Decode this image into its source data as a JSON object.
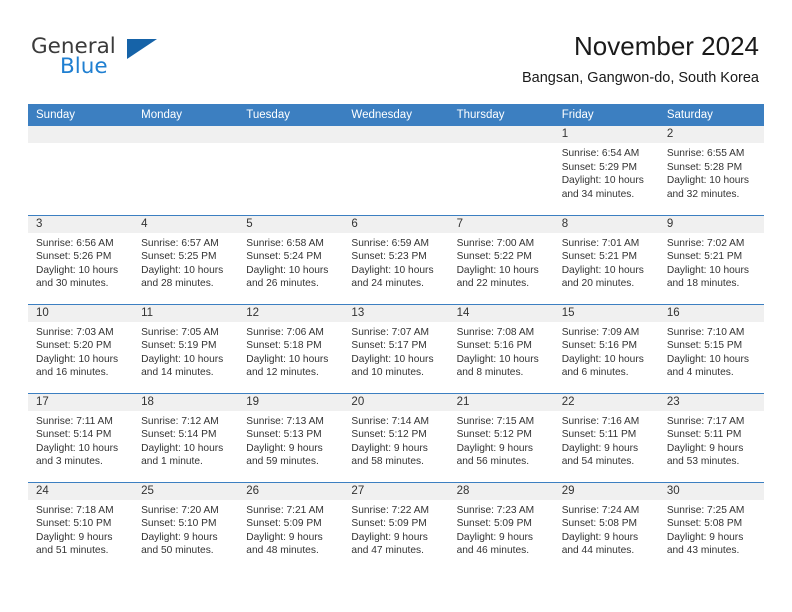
{
  "logo": {
    "word1": "General",
    "word2": "Blue",
    "triangle_color": "#1663a8",
    "blue_text_color": "#1f7fd1"
  },
  "header": {
    "title": "November 2024",
    "location": "Bangsan, Gangwon-do, South Korea"
  },
  "theme": {
    "header_blue": "#3c7fc1",
    "daynum_band": "#f0f0f0",
    "text": "#333333"
  },
  "weekday_headers": [
    "Sunday",
    "Monday",
    "Tuesday",
    "Wednesday",
    "Thursday",
    "Friday",
    "Saturday"
  ],
  "labels": {
    "sunrise_prefix": "Sunrise:",
    "sunset_prefix": "Sunset:",
    "daylight_prefix": "Daylight:"
  },
  "weeks": [
    [
      {
        "day": "",
        "empty": true
      },
      {
        "day": "",
        "empty": true
      },
      {
        "day": "",
        "empty": true
      },
      {
        "day": "",
        "empty": true
      },
      {
        "day": "",
        "empty": true
      },
      {
        "day": "1",
        "sunrise": "Sunrise: 6:54 AM",
        "sunset": "Sunset: 5:29 PM",
        "daylight": "Daylight: 10 hours and 34 minutes."
      },
      {
        "day": "2",
        "sunrise": "Sunrise: 6:55 AM",
        "sunset": "Sunset: 5:28 PM",
        "daylight": "Daylight: 10 hours and 32 minutes."
      }
    ],
    [
      {
        "day": "3",
        "sunrise": "Sunrise: 6:56 AM",
        "sunset": "Sunset: 5:26 PM",
        "daylight": "Daylight: 10 hours and 30 minutes."
      },
      {
        "day": "4",
        "sunrise": "Sunrise: 6:57 AM",
        "sunset": "Sunset: 5:25 PM",
        "daylight": "Daylight: 10 hours and 28 minutes."
      },
      {
        "day": "5",
        "sunrise": "Sunrise: 6:58 AM",
        "sunset": "Sunset: 5:24 PM",
        "daylight": "Daylight: 10 hours and 26 minutes."
      },
      {
        "day": "6",
        "sunrise": "Sunrise: 6:59 AM",
        "sunset": "Sunset: 5:23 PM",
        "daylight": "Daylight: 10 hours and 24 minutes."
      },
      {
        "day": "7",
        "sunrise": "Sunrise: 7:00 AM",
        "sunset": "Sunset: 5:22 PM",
        "daylight": "Daylight: 10 hours and 22 minutes."
      },
      {
        "day": "8",
        "sunrise": "Sunrise: 7:01 AM",
        "sunset": "Sunset: 5:21 PM",
        "daylight": "Daylight: 10 hours and 20 minutes."
      },
      {
        "day": "9",
        "sunrise": "Sunrise: 7:02 AM",
        "sunset": "Sunset: 5:21 PM",
        "daylight": "Daylight: 10 hours and 18 minutes."
      }
    ],
    [
      {
        "day": "10",
        "sunrise": "Sunrise: 7:03 AM",
        "sunset": "Sunset: 5:20 PM",
        "daylight": "Daylight: 10 hours and 16 minutes."
      },
      {
        "day": "11",
        "sunrise": "Sunrise: 7:05 AM",
        "sunset": "Sunset: 5:19 PM",
        "daylight": "Daylight: 10 hours and 14 minutes."
      },
      {
        "day": "12",
        "sunrise": "Sunrise: 7:06 AM",
        "sunset": "Sunset: 5:18 PM",
        "daylight": "Daylight: 10 hours and 12 minutes."
      },
      {
        "day": "13",
        "sunrise": "Sunrise: 7:07 AM",
        "sunset": "Sunset: 5:17 PM",
        "daylight": "Daylight: 10 hours and 10 minutes."
      },
      {
        "day": "14",
        "sunrise": "Sunrise: 7:08 AM",
        "sunset": "Sunset: 5:16 PM",
        "daylight": "Daylight: 10 hours and 8 minutes."
      },
      {
        "day": "15",
        "sunrise": "Sunrise: 7:09 AM",
        "sunset": "Sunset: 5:16 PM",
        "daylight": "Daylight: 10 hours and 6 minutes."
      },
      {
        "day": "16",
        "sunrise": "Sunrise: 7:10 AM",
        "sunset": "Sunset: 5:15 PM",
        "daylight": "Daylight: 10 hours and 4 minutes."
      }
    ],
    [
      {
        "day": "17",
        "sunrise": "Sunrise: 7:11 AM",
        "sunset": "Sunset: 5:14 PM",
        "daylight": "Daylight: 10 hours and 3 minutes."
      },
      {
        "day": "18",
        "sunrise": "Sunrise: 7:12 AM",
        "sunset": "Sunset: 5:14 PM",
        "daylight": "Daylight: 10 hours and 1 minute."
      },
      {
        "day": "19",
        "sunrise": "Sunrise: 7:13 AM",
        "sunset": "Sunset: 5:13 PM",
        "daylight": "Daylight: 9 hours and 59 minutes."
      },
      {
        "day": "20",
        "sunrise": "Sunrise: 7:14 AM",
        "sunset": "Sunset: 5:12 PM",
        "daylight": "Daylight: 9 hours and 58 minutes."
      },
      {
        "day": "21",
        "sunrise": "Sunrise: 7:15 AM",
        "sunset": "Sunset: 5:12 PM",
        "daylight": "Daylight: 9 hours and 56 minutes."
      },
      {
        "day": "22",
        "sunrise": "Sunrise: 7:16 AM",
        "sunset": "Sunset: 5:11 PM",
        "daylight": "Daylight: 9 hours and 54 minutes."
      },
      {
        "day": "23",
        "sunrise": "Sunrise: 7:17 AM",
        "sunset": "Sunset: 5:11 PM",
        "daylight": "Daylight: 9 hours and 53 minutes."
      }
    ],
    [
      {
        "day": "24",
        "sunrise": "Sunrise: 7:18 AM",
        "sunset": "Sunset: 5:10 PM",
        "daylight": "Daylight: 9 hours and 51 minutes."
      },
      {
        "day": "25",
        "sunrise": "Sunrise: 7:20 AM",
        "sunset": "Sunset: 5:10 PM",
        "daylight": "Daylight: 9 hours and 50 minutes."
      },
      {
        "day": "26",
        "sunrise": "Sunrise: 7:21 AM",
        "sunset": "Sunset: 5:09 PM",
        "daylight": "Daylight: 9 hours and 48 minutes."
      },
      {
        "day": "27",
        "sunrise": "Sunrise: 7:22 AM",
        "sunset": "Sunset: 5:09 PM",
        "daylight": "Daylight: 9 hours and 47 minutes."
      },
      {
        "day": "28",
        "sunrise": "Sunrise: 7:23 AM",
        "sunset": "Sunset: 5:09 PM",
        "daylight": "Daylight: 9 hours and 46 minutes."
      },
      {
        "day": "29",
        "sunrise": "Sunrise: 7:24 AM",
        "sunset": "Sunset: 5:08 PM",
        "daylight": "Daylight: 9 hours and 44 minutes."
      },
      {
        "day": "30",
        "sunrise": "Sunrise: 7:25 AM",
        "sunset": "Sunset: 5:08 PM",
        "daylight": "Daylight: 9 hours and 43 minutes."
      }
    ]
  ]
}
